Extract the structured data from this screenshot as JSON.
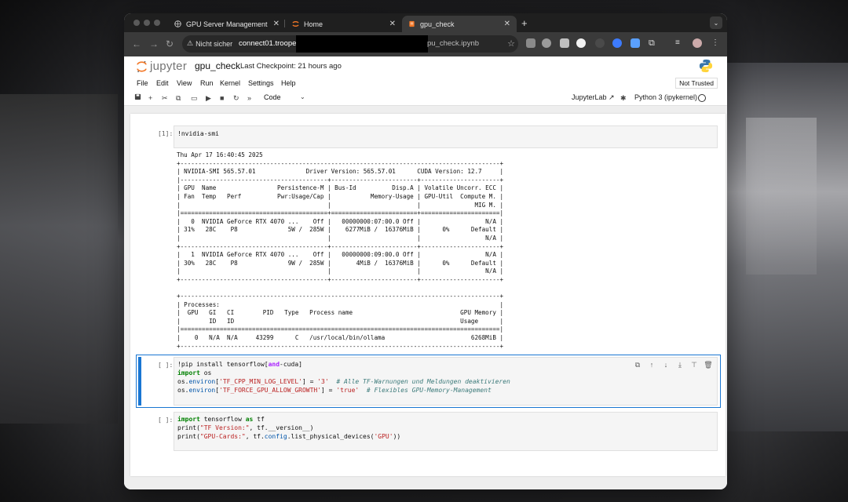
{
  "browser": {
    "tabs": [
      {
        "title": "GPU Server Management of",
        "icon": "gpu-icon"
      },
      {
        "title": "Home",
        "icon": "jupyter-icon"
      },
      {
        "title": "gpu_check",
        "icon": "notebook-icon",
        "active": true
      }
    ],
    "new_tab": "+",
    "security_label": "Nicht sicher",
    "url_prefix": "connect01.troope",
    "url_suffix": "pu_check.ipynb"
  },
  "jupyter": {
    "logo_text": "jupyter",
    "notebook_name": "gpu_check",
    "checkpoint": "Last Checkpoint: 21 hours ago",
    "menu": [
      "File",
      "Edit",
      "View",
      "Run",
      "Kernel",
      "Settings",
      "Help"
    ],
    "trust": "Not Trusted",
    "toolbar": {
      "cell_type": "Code",
      "jupyterlab_link": "JupyterLab",
      "kernel_name": "Python 3 (ipykernel)"
    }
  },
  "cells": {
    "c1": {
      "prompt": "[1]:",
      "code": "!nvidia-smi",
      "output": [
        "Thu Apr 17 16:40:45 2025",
        "+-----------------------------------------------------------------------------------------+",
        "| NVIDIA-SMI 565.57.01              Driver Version: 565.57.01      CUDA Version: 12.7     |",
        "|-----------------------------------------+------------------------+----------------------+",
        "| GPU  Name                 Persistence-M | Bus-Id          Disp.A | Volatile Uncorr. ECC |",
        "| Fan  Temp   Perf          Pwr:Usage/Cap |           Memory-Usage | GPU-Util  Compute M. |",
        "|                                         |                        |               MIG M. |",
        "|=========================================+========================+======================|",
        "|   0  NVIDIA GeForce RTX 4070 ...    Off |   00000000:07:00.0 Off |                  N/A |",
        "| 31%   28C    P8              5W /  285W |    6277MiB /  16376MiB |      0%      Default |",
        "|                                         |                        |                  N/A |",
        "+-----------------------------------------+------------------------+----------------------+",
        "|   1  NVIDIA GeForce RTX 4070 ...    Off |   00000000:09:00.0 Off |                  N/A |",
        "| 30%   28C    P8              9W /  285W |       4MiB /  16376MiB |      0%      Default |",
        "|                                         |                        |                  N/A |",
        "+-----------------------------------------+------------------------+----------------------+",
        "",
        "+-----------------------------------------------------------------------------------------+",
        "| Processes:                                                                              |",
        "|  GPU   GI   CI        PID   Type   Process name                              GPU Memory |",
        "|        ID   ID                                                               Usage      |",
        "|=========================================================================================|",
        "|    0   N/A  N/A     43299      C   /usr/local/bin/ollama                        6268MiB |",
        "+-----------------------------------------------------------------------------------------+"
      ]
    },
    "c2": {
      "prompt": "[ ]:",
      "l1a": "!pip install tensorflow[",
      "l1kw": "and",
      "l1b": "-cuda]",
      "l2kw": "import",
      "l2b": " os",
      "l3a": "os.",
      "l3attr": "environ",
      "l3b": "[",
      "l3s1": "'TF_CPP_MIN_LOG_LEVEL'",
      "l3c": "] = ",
      "l3s2": "'3'",
      "l3cm": "  # Alle TF-Warnungen und Meldungen deaktivieren",
      "l4a": "os.",
      "l4attr": "environ",
      "l4b": "[",
      "l4s1": "'TF_FORCE_GPU_ALLOW_GROWTH'",
      "l4c": "] = ",
      "l4s2": "'true'",
      "l4cm": "  # Flexibles GPU-Memory-Management"
    },
    "c3": {
      "prompt": "[ ]:",
      "l1kw": "import",
      "l1b": " tensorflow ",
      "l1kw2": "as",
      "l1c": " tf",
      "l2a": "print(",
      "l2s": "\"TF Version:\"",
      "l2b": ", tf.__version__)",
      "l3a": "print(",
      "l3s": "\"GPU-Cards:\"",
      "l3b": ", tf.",
      "l3attr": "config",
      "l3c": ".list_physical_devices(",
      "l3s2": "'GPU'",
      "l3d": "))"
    }
  }
}
